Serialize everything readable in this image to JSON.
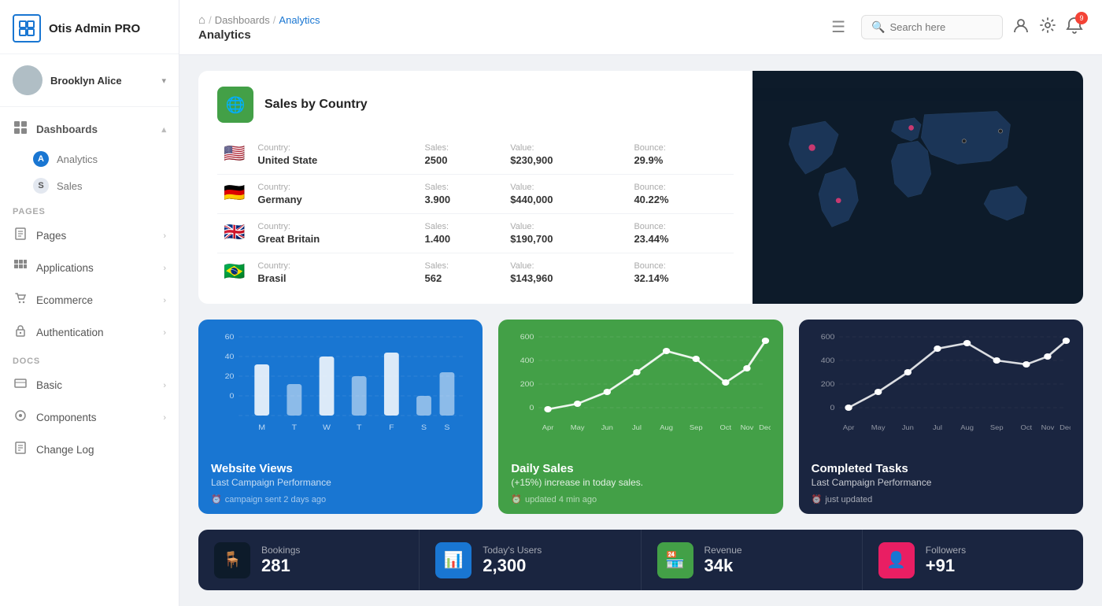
{
  "app": {
    "name": "Otis Admin PRO"
  },
  "user": {
    "name": "Brooklyn Alice"
  },
  "sidebar": {
    "sections": [
      {
        "label": "",
        "items": [
          {
            "id": "dashboards",
            "icon": "⊞",
            "label": "Dashboards",
            "expanded": true,
            "children": [
              {
                "letter": "A",
                "label": "Analytics",
                "active": true
              },
              {
                "letter": "S",
                "label": "Sales",
                "active": false
              }
            ]
          }
        ]
      },
      {
        "label": "PAGES",
        "items": [
          {
            "id": "pages",
            "icon": "🖼",
            "label": "Pages"
          },
          {
            "id": "applications",
            "icon": "⋮⋮",
            "label": "Applications"
          },
          {
            "id": "ecommerce",
            "icon": "🛍",
            "label": "Ecommerce"
          },
          {
            "id": "authentication",
            "icon": "📋",
            "label": "Authentication"
          }
        ]
      },
      {
        "label": "DOCS",
        "items": [
          {
            "id": "basic",
            "icon": "📚",
            "label": "Basic"
          },
          {
            "id": "components",
            "icon": "⚙",
            "label": "Components"
          },
          {
            "id": "changelog",
            "icon": "📝",
            "label": "Change Log"
          }
        ]
      }
    ]
  },
  "topbar": {
    "breadcrumbs": [
      "Dashboards",
      "Analytics"
    ],
    "page_title": "Analytics",
    "search_placeholder": "Search here",
    "notif_count": "9"
  },
  "sales_by_country": {
    "title": "Sales by Country",
    "rows": [
      {
        "flag": "🇺🇸",
        "country_label": "Country:",
        "country": "United State",
        "sales_label": "Sales:",
        "sales": "2500",
        "value_label": "Value:",
        "value": "$230,900",
        "bounce_label": "Bounce:",
        "bounce": "29.9%"
      },
      {
        "flag": "🇩🇪",
        "country_label": "Country:",
        "country": "Germany",
        "sales_label": "Sales:",
        "sales": "3.900",
        "value_label": "Value:",
        "value": "$440,000",
        "bounce_label": "Bounce:",
        "bounce": "40.22%"
      },
      {
        "flag": "🇬🇧",
        "country_label": "Country:",
        "country": "Great Britain",
        "sales_label": "Sales:",
        "sales": "1.400",
        "value_label": "Value:",
        "value": "$190,700",
        "bounce_label": "Bounce:",
        "bounce": "23.44%"
      },
      {
        "flag": "🇧🇷",
        "country_label": "Country:",
        "country": "Brasil",
        "sales_label": "Sales:",
        "sales": "562",
        "value_label": "Value:",
        "value": "$143,960",
        "bounce_label": "Bounce:",
        "bounce": "32.14%"
      }
    ]
  },
  "chart_website_views": {
    "title": "Website Views",
    "subtitle": "Last Campaign Performance",
    "footer": "campaign sent 2 days ago",
    "labels": [
      "M",
      "T",
      "W",
      "T",
      "F",
      "S",
      "S"
    ],
    "values": [
      40,
      20,
      50,
      25,
      55,
      10,
      35
    ]
  },
  "chart_daily_sales": {
    "title": "Daily Sales",
    "subtitle": "(+15%) increase in today sales.",
    "footer": "updated 4 min ago",
    "labels": [
      "Apr",
      "May",
      "Jun",
      "Jul",
      "Aug",
      "Sep",
      "Oct",
      "Nov",
      "Dec"
    ],
    "values": [
      20,
      80,
      150,
      280,
      420,
      380,
      220,
      310,
      500
    ]
  },
  "chart_completed_tasks": {
    "title": "Completed Tasks",
    "subtitle": "Last Campaign Performance",
    "footer": "just updated",
    "labels": [
      "Apr",
      "May",
      "Jun",
      "Jul",
      "Aug",
      "Sep",
      "Oct",
      "Nov",
      "Dec"
    ],
    "values": [
      20,
      100,
      220,
      380,
      460,
      300,
      280,
      350,
      500
    ]
  },
  "stats": [
    {
      "icon": "🪑",
      "icon_class": "dark-icon",
      "label": "Bookings",
      "value": "281"
    },
    {
      "icon": "📊",
      "icon_class": "blue-icon",
      "label": "Today's Users",
      "value": "2,300"
    },
    {
      "icon": "🏪",
      "icon_class": "green-icon",
      "label": "Revenue",
      "value": "34k"
    },
    {
      "icon": "👤",
      "icon_class": "pink-icon",
      "label": "Followers",
      "value": "+91"
    }
  ]
}
